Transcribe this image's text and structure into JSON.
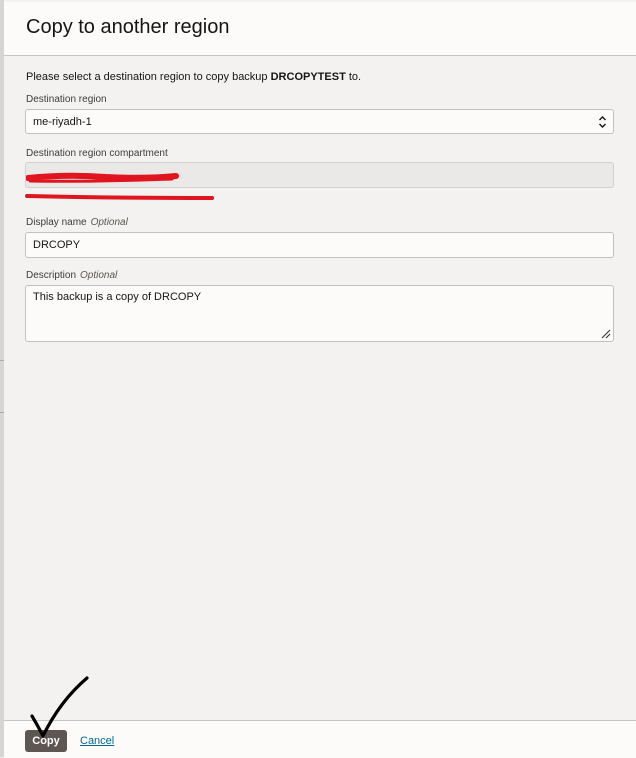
{
  "dialog": {
    "title": "Copy to another region",
    "intro_prefix": "Please select a destination region to copy backup ",
    "backup_name": "DRCOPYTEST",
    "intro_suffix": " to."
  },
  "form": {
    "destination_region": {
      "label": "Destination region",
      "value": "me-riyadh-1"
    },
    "compartment": {
      "label": "Destination region compartment",
      "value": ""
    },
    "display_name": {
      "label": "Display name",
      "optional": "Optional",
      "value": "DRCOPY"
    },
    "description": {
      "label": "Description",
      "optional": "Optional",
      "value": "This backup is a copy of DRCOPY"
    }
  },
  "footer": {
    "copy_label": "Copy",
    "cancel_label": "Cancel"
  },
  "icons": {
    "select": "chevron-updown-icon",
    "resize": "resize-handle-icon",
    "annotation": "checkmark-icon"
  },
  "colors": {
    "primary_button": "#5d5652",
    "link": "#00688c",
    "redaction": "#e0151f"
  }
}
